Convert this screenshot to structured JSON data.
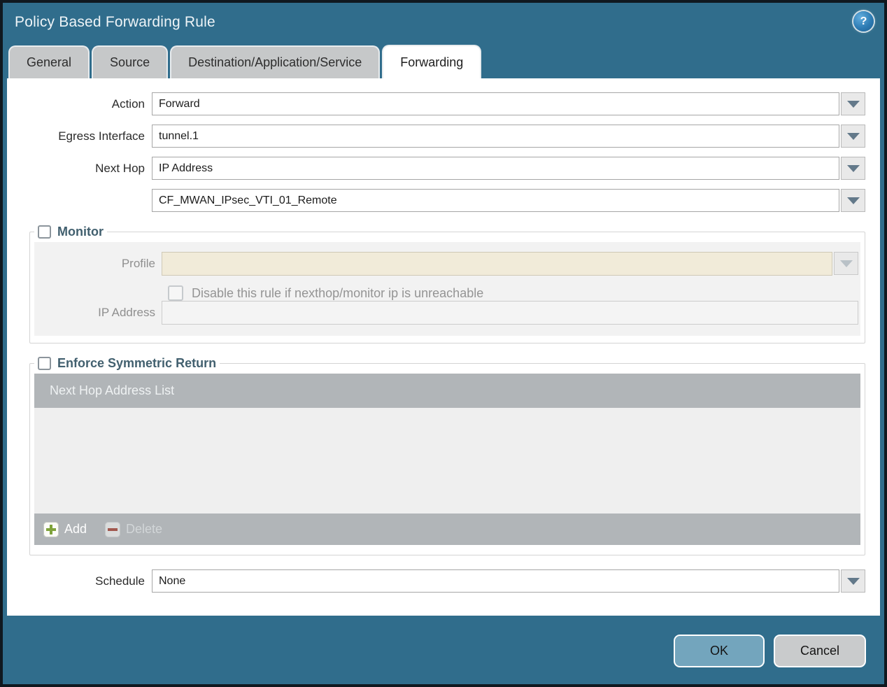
{
  "dialog": {
    "title": "Policy Based Forwarding Rule"
  },
  "tabs": [
    {
      "label": "General",
      "active": false
    },
    {
      "label": "Source",
      "active": false
    },
    {
      "label": "Destination/Application/Service",
      "active": false
    },
    {
      "label": "Forwarding",
      "active": true
    }
  ],
  "form": {
    "action": {
      "label": "Action",
      "value": "Forward"
    },
    "egress_interface": {
      "label": "Egress Interface",
      "value": "tunnel.1"
    },
    "next_hop": {
      "label": "Next Hop",
      "value": "IP Address"
    },
    "next_hop_address": {
      "value": "CF_MWAN_IPsec_VTI_01_Remote"
    },
    "schedule": {
      "label": "Schedule",
      "value": "None"
    }
  },
  "monitor": {
    "legend": "Monitor",
    "checked": false,
    "profile": {
      "label": "Profile",
      "value": ""
    },
    "disable_rule": {
      "label": "Disable this rule if nexthop/monitor ip is unreachable",
      "checked": false
    },
    "ip_address": {
      "label": "IP Address",
      "value": ""
    }
  },
  "symmetric_return": {
    "legend": "Enforce Symmetric Return",
    "checked": false,
    "table": {
      "header": "Next Hop Address List",
      "rows": []
    },
    "add_label": "Add",
    "delete_label": "Delete"
  },
  "footer": {
    "ok_label": "OK",
    "cancel_label": "Cancel"
  },
  "icons": {
    "help": "?-in-circle",
    "add": "green-plus",
    "delete": "red-minus",
    "dropdown": "down-triangle"
  },
  "colors": {
    "chrome_teal": "#306d8c",
    "active_tab": "#ffffff",
    "inactive_tab": "#c6c8c9",
    "table_header": "#b1b5b8",
    "disabled_field_beige": "#f1ebd9",
    "ok_button": "#73a5bd",
    "cancel_button": "#c9cbcc",
    "legend_text": "#42606f"
  }
}
